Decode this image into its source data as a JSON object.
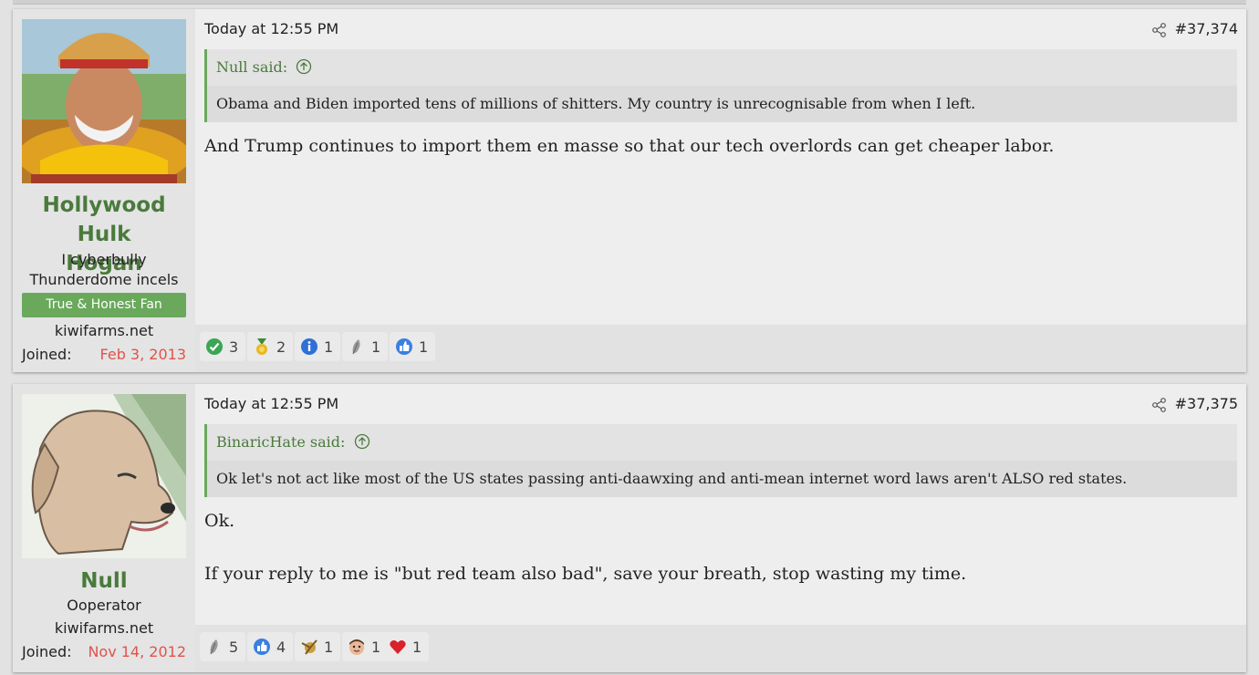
{
  "posts": [
    {
      "username_line1": "Hollywood Hulk",
      "username_line2": "Hogan",
      "title_line1": "I cyberbully",
      "title_line2": "Thunderdome incels",
      "banner": "True & Honest Fan",
      "site": "kiwifarms.net",
      "joined_label": "Joined:",
      "joined_date": "Feb 3, 2013",
      "timestamp": "Today at 12:55 PM",
      "post_number": "#37,374",
      "quote_author": "Null said:",
      "quote_text": "Obama and Biden imported tens of millions of shitters. My country is unrecognisable from when I left.",
      "body_line1": "And Trump continues to import them en masse so that our tech overlords can get cheaper labor.",
      "reactions": [
        {
          "icon": "check-icon",
          "count": "3"
        },
        {
          "icon": "medal-icon",
          "count": "2"
        },
        {
          "icon": "info-icon",
          "count": "1"
        },
        {
          "icon": "feather-icon",
          "count": "1"
        },
        {
          "icon": "thumbs-up-icon",
          "count": "1"
        }
      ]
    },
    {
      "username_line1": "Null",
      "title_line1": "Ooperator",
      "site": "kiwifarms.net",
      "joined_label": "Joined:",
      "joined_date": "Nov 14, 2012",
      "timestamp": "Today at 12:55 PM",
      "post_number": "#37,375",
      "quote_author": "BinaricHate said:",
      "quote_text": "Ok let's not act like most of the US states passing anti-daawxing and anti-mean internet word laws aren't ALSO red states.",
      "body_line1": "Ok.",
      "body_line2": "If your reply to me is \"but red team also bad\", save your breath, stop wasting my time.",
      "reactions": [
        {
          "icon": "feather-icon",
          "count": "5"
        },
        {
          "icon": "thumbs-up-icon",
          "count": "4"
        },
        {
          "icon": "emblem-icon",
          "count": "1"
        },
        {
          "icon": "face-icon",
          "count": "1"
        },
        {
          "icon": "heart-icon",
          "count": "1"
        }
      ]
    }
  ],
  "colors": {
    "accent": "#4a7a3c",
    "banner": "#6aa85c",
    "joined_date": "#e0534b"
  }
}
